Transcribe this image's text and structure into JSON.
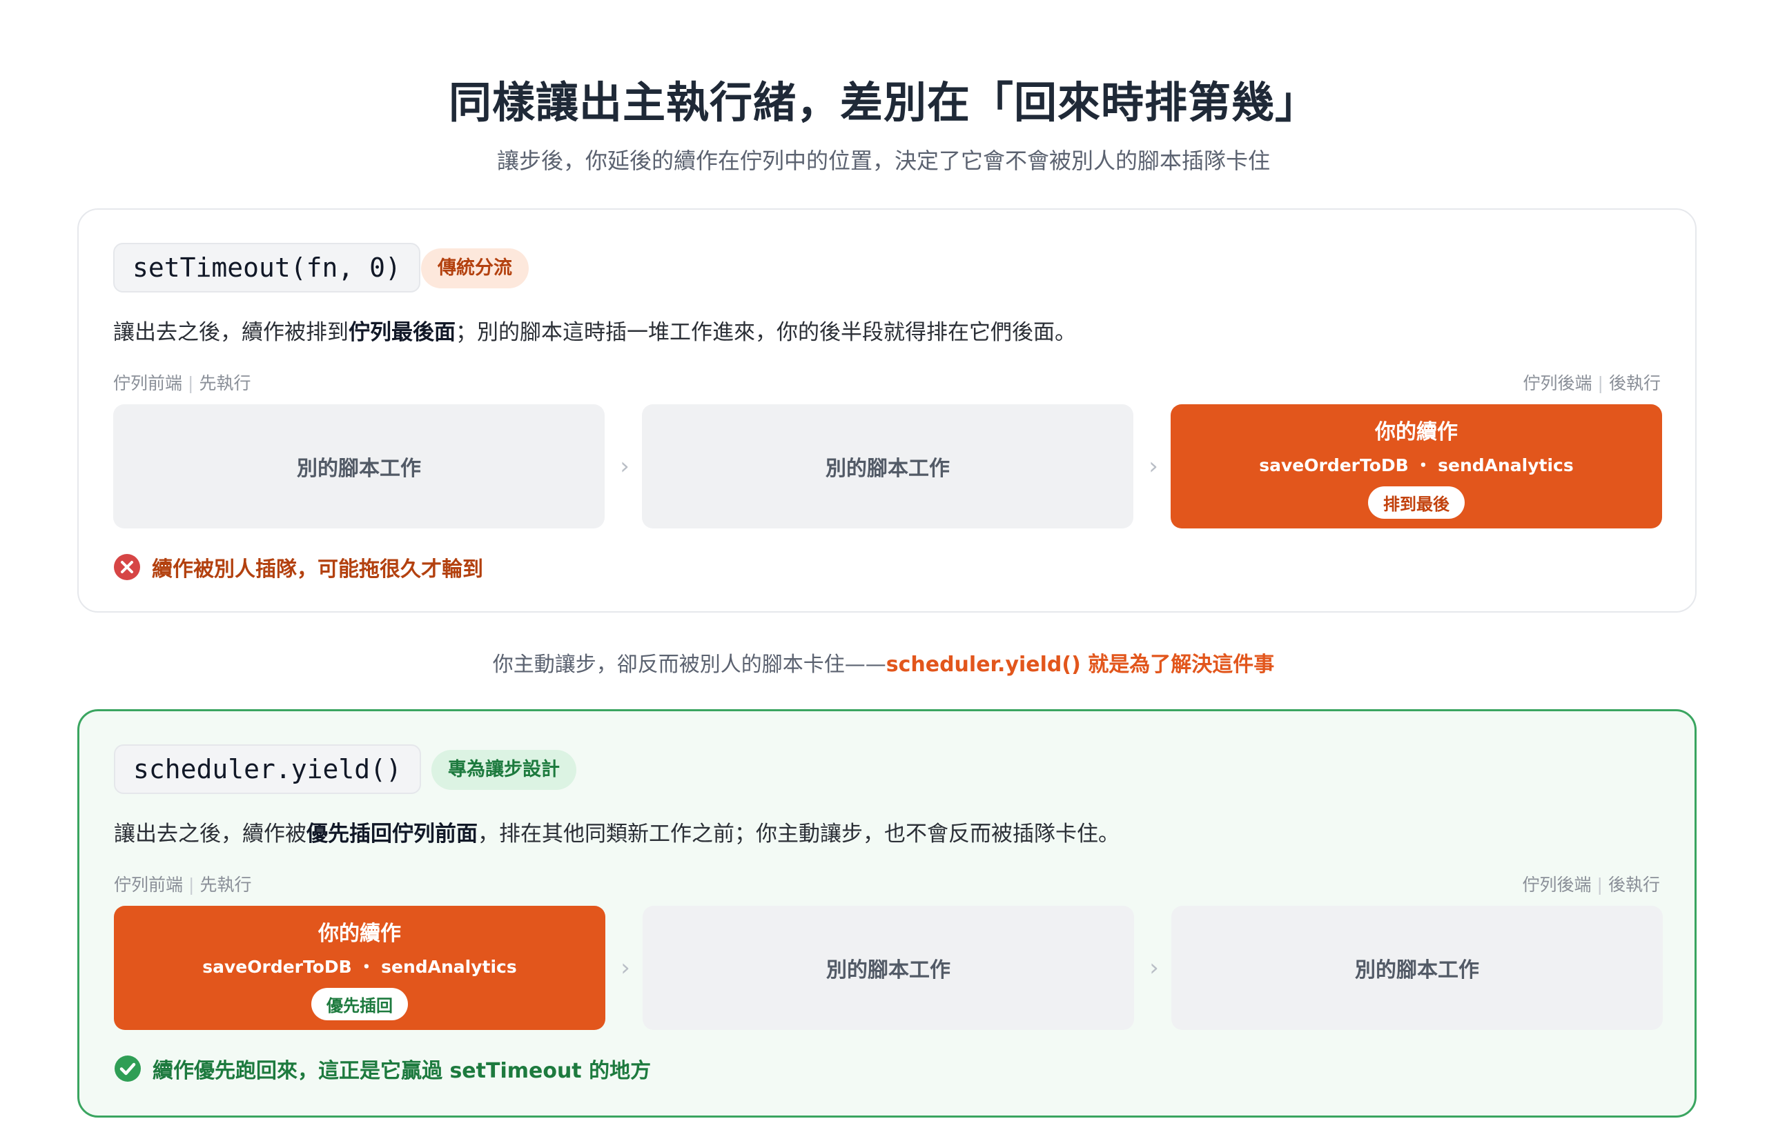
{
  "title": "同樣讓出主執行緒，差別在「回來時排第幾」",
  "subtitle": "讓步後，你延後的續作在佇列中的位置，決定了它會不會被別人的腳本插隊卡住",
  "colors": {
    "accent_orange": "#e2561c",
    "success_green": "#3aa560",
    "error_red": "#d64545"
  },
  "top_card": {
    "code": "setTimeout(fn, 0)",
    "tag": "傳統分流",
    "desc_pre": "讓出去之後，續作被排到",
    "desc_bold": "佇列最後面",
    "desc_post": "；別的腳本這時插一堆工作進來，你的後半段就得排在它們後面。",
    "axis_left_a": "佇列前端",
    "axis_left_b": "先執行",
    "axis_right_a": "佇列後端",
    "axis_right_b": "後執行",
    "slot1": "別的腳本工作",
    "slot2": "別的腳本工作",
    "mine_title": "你的續作",
    "mine_sub": "saveOrderToDB ・ sendAnalytics",
    "mine_pill": "排到最後",
    "result": "續作被別人插隊，可能拖很久才輪到"
  },
  "bridge": {
    "text": "你主動讓步，卻反而被別人的腳本卡住——",
    "highlight": "scheduler.yield() 就是為了解決這件事"
  },
  "bottom_card": {
    "code": "scheduler.yield()",
    "tag": "專為讓步設計",
    "desc_pre": "讓出去之後，續作被",
    "desc_bold": "優先插回佇列前面",
    "desc_post": "，排在其他同類新工作之前；你主動讓步，也不會反而被插隊卡住。",
    "axis_left_a": "佇列前端",
    "axis_left_b": "先執行",
    "axis_right_a": "佇列後端",
    "axis_right_b": "後執行",
    "mine_title": "你的續作",
    "mine_sub": "saveOrderToDB ・ sendAnalytics",
    "mine_pill": "優先插回",
    "slot2": "別的腳本工作",
    "slot3": "別的腳本工作",
    "result": "續作優先跑回來，這正是它贏過 setTimeout 的地方"
  }
}
